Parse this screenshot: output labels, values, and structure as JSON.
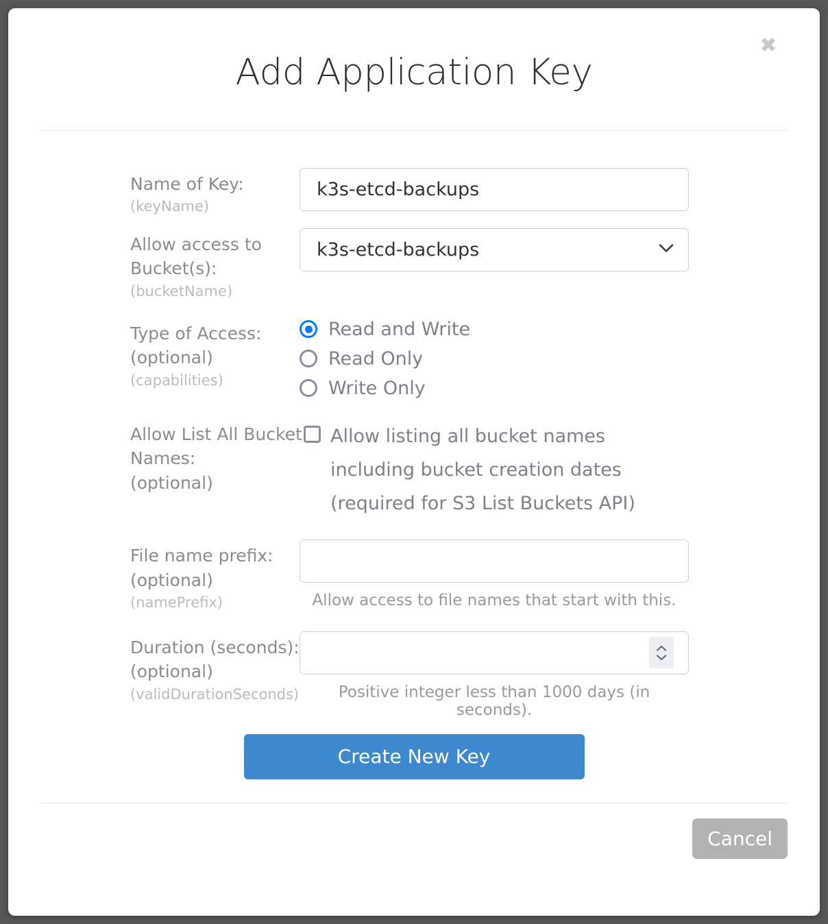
{
  "dialog": {
    "title": "Add Application Key",
    "close_icon": "close-icon",
    "close_glyph": "✖"
  },
  "fields": {
    "key_name": {
      "label": "Name of Key:",
      "api_name": "(keyName)",
      "value": "k3s-etcd-backups"
    },
    "bucket": {
      "label": "Allow access to Bucket(s):",
      "api_name": "(bucketName)",
      "selected": "k3s-etcd-backups",
      "options": [
        "k3s-etcd-backups"
      ]
    },
    "access_type": {
      "label": "Type of Access:",
      "label_optional": "(optional)",
      "api_name": "(capabilities)",
      "options": [
        {
          "label": "Read and Write",
          "selected": true
        },
        {
          "label": "Read Only",
          "selected": false
        },
        {
          "label": "Write Only",
          "selected": false
        }
      ]
    },
    "list_all_buckets": {
      "label": "Allow List All Bucket Names:",
      "label_optional": "(optional)",
      "checkbox_label": "Allow listing all bucket names including bucket creation dates (required for S3 List Buckets API)",
      "checked": false
    },
    "name_prefix": {
      "label": "File name prefix:",
      "label_optional": "(optional)",
      "api_name": "(namePrefix)",
      "value": "",
      "helper": "Allow access to file names that start with this."
    },
    "duration": {
      "label": "Duration (seconds):",
      "label_optional": "(optional)",
      "api_name": "(validDurationSeconds)",
      "value": "",
      "helper": "Positive integer less than 1000 days (in seconds)."
    }
  },
  "actions": {
    "create": "Create New Key",
    "cancel": "Cancel"
  },
  "colors": {
    "primary": "#3d88ce",
    "radio_selected": "#007bff",
    "cancel": "#b2b2b2",
    "label": "#8c8c8c",
    "api_label": "#bcbcbc",
    "backdrop": "#575757"
  }
}
